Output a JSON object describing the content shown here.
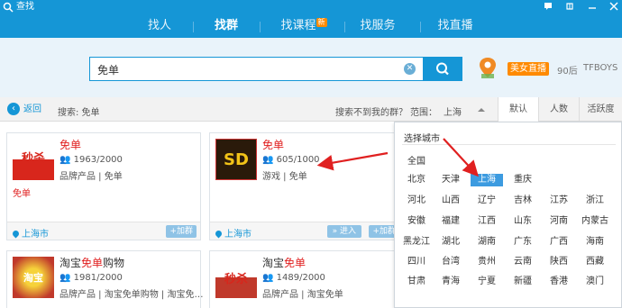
{
  "titlebar": {
    "title": "查找"
  },
  "nav": {
    "tabs": [
      {
        "label": "找人"
      },
      {
        "label": "找群"
      },
      {
        "label": "找课程",
        "badge": "新"
      },
      {
        "label": "找服务"
      },
      {
        "label": "找直播"
      }
    ],
    "active_index": 1
  },
  "search": {
    "value": "免单"
  },
  "hot": {
    "badge": "美女直播",
    "words": [
      "90后",
      "TFBOYS"
    ]
  },
  "filter": {
    "back": "返回",
    "crumb": "搜索: 免单",
    "not_found": "搜索不到我的群？",
    "range_label": "范围：",
    "city": "上海",
    "sort_tabs": [
      "默认",
      "人数",
      "活跃度"
    ]
  },
  "cards": [
    {
      "name_prefix": "",
      "name_hl": "免单",
      "name_suffix": "",
      "members": "1963/2000",
      "tags": "品牌产品 | 免单",
      "red_tag": "免单",
      "location": "上海市",
      "join": "+加群",
      "pic_text": "秒杀"
    },
    {
      "name_prefix": "",
      "name_hl": "免单",
      "name_suffix": "",
      "members": "605/1000",
      "tags": "游戏 | 免单",
      "red_tag": "",
      "location": "上海市",
      "join": "+加群",
      "enter": "» 进入",
      "pic_text": "SD"
    },
    {
      "name_prefix": "淘宝",
      "name_hl": "免单",
      "name_suffix": "购物",
      "members": "1981/2000",
      "tags": "品牌产品 | 淘宝免单购物 | 淘宝免…",
      "red_tag": "",
      "location": "",
      "join": "",
      "pic_text": "淘宝"
    },
    {
      "name_prefix": "淘宝",
      "name_hl": "免单",
      "name_suffix": "",
      "members": "1489/2000",
      "tags": "品牌产品 | 淘宝免单",
      "red_tag": "",
      "location": "",
      "join": "",
      "pic_text": "秒杀"
    }
  ],
  "city_popup": {
    "title": "选择城市",
    "all": "全国",
    "rows": [
      [
        "北京",
        "天津",
        "上海",
        "重庆"
      ],
      [
        "河北",
        "山西",
        "辽宁",
        "吉林",
        "江苏",
        "浙江"
      ],
      [
        "安徽",
        "福建",
        "江西",
        "山东",
        "河南",
        "内蒙古"
      ],
      [
        "黑龙江",
        "湖北",
        "湖南",
        "广东",
        "广西",
        "海南"
      ],
      [
        "四川",
        "台湾",
        "贵州",
        "云南",
        "陕西",
        "西藏"
      ],
      [
        "甘肃",
        "青海",
        "宁夏",
        "新疆",
        "香港",
        "澳门"
      ]
    ],
    "selected": "上海"
  },
  "colors": {
    "brand": "#1596d6",
    "highlight": "#e02020",
    "badge": "#ff8a00",
    "arrow": "#e02020"
  }
}
